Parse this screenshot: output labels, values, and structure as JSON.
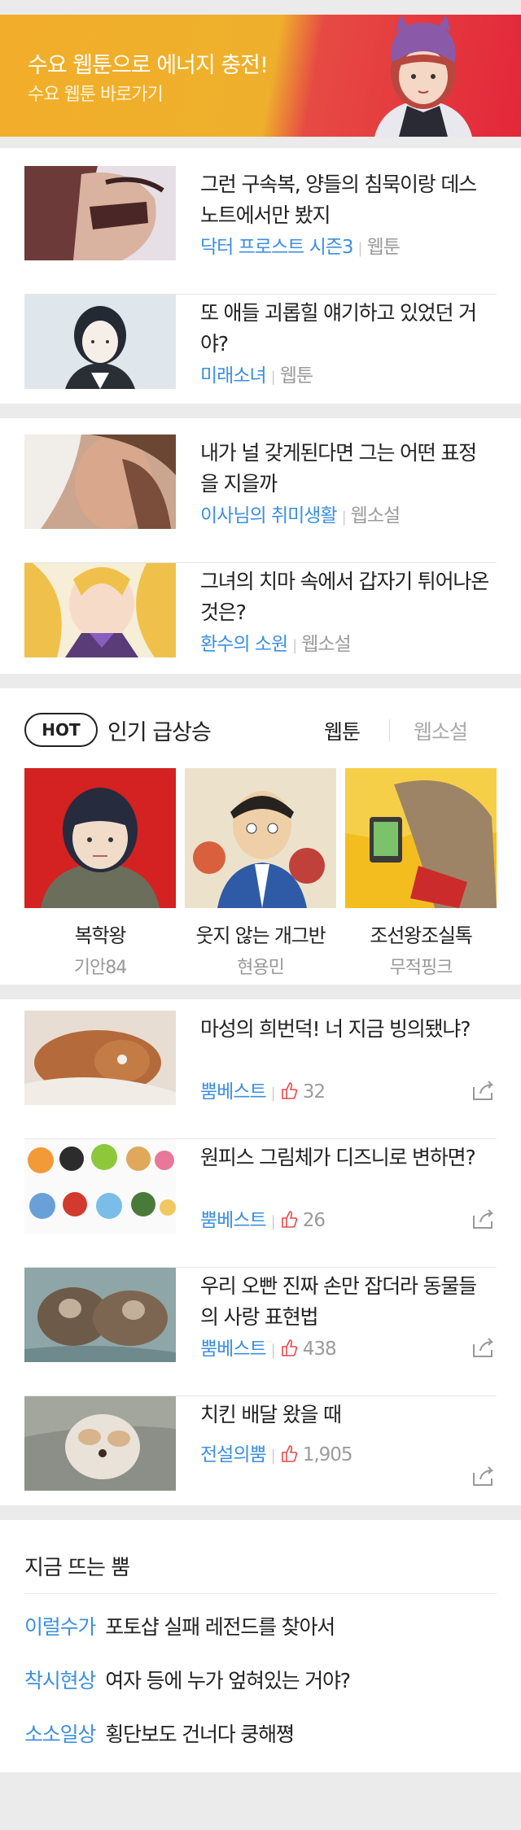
{
  "banner": {
    "title": "수요 웹툰으로 에너지 충전!",
    "subtitle": "수요 웹툰 바로가기"
  },
  "comics": [
    {
      "title": "그런 구속복, 양들의 침묵이랑 데스노트에서만 봤지",
      "source": "닥터 프로스트 시즌3",
      "kind": "웹툰"
    },
    {
      "title": "또 애들 괴롭힐 얘기하고 있었던 거야?",
      "source": "미래소녀",
      "kind": "웹툰"
    }
  ],
  "novels": [
    {
      "title": "내가 널 갖게된다면 그는 어떤 표정을 지을까",
      "source": "이사님의 취미생활",
      "kind": "웹소설"
    },
    {
      "title": "그녀의 치마 속에서 갑자기 튀어나온 것은?",
      "source": "환수의 소원",
      "kind": "웹소설"
    }
  ],
  "hot": {
    "badge": "HOT",
    "title": "인기 급상승",
    "tabs": [
      "웹툰",
      "웹소설"
    ],
    "items": [
      {
        "name": "복학왕",
        "author": "기안84"
      },
      {
        "name": "웃지 않는 개그반",
        "author": "현용민"
      },
      {
        "name": "조선왕조실톡",
        "author": "무적핑크"
      }
    ]
  },
  "bbom": [
    {
      "title": "마성의 희번덕! 너 지금 빙의됐냐?",
      "source": "뿜베스트",
      "likes": "32"
    },
    {
      "title": "원피스 그림체가 디즈니로 변하면?",
      "source": "뿜베스트",
      "likes": "26"
    },
    {
      "title": "우리 오빤 진짜 손만 잡더라 동물들의 사랑 표현법",
      "source": "뿜베스트",
      "likes": "438"
    },
    {
      "title": "치킨 배달 왔을 때",
      "source": "전설의뿜",
      "likes": "1,905"
    }
  ],
  "trending": {
    "title": "지금 뜨는 뿜",
    "items": [
      {
        "category": "이럴수가",
        "text": "포토샵 실패 레전드를 찾아서"
      },
      {
        "category": "착시현상",
        "text": "여자 등에 누가 엎혀있는 거야?"
      },
      {
        "category": "소소일상",
        "text": "횡단보도 건너다 쿵해쪙"
      }
    ]
  },
  "colors": {
    "accent": "#3d8fe0",
    "bannerYellow": "#f2ae2a",
    "bannerRed": "#e3273a",
    "heart": "#e8484a"
  }
}
